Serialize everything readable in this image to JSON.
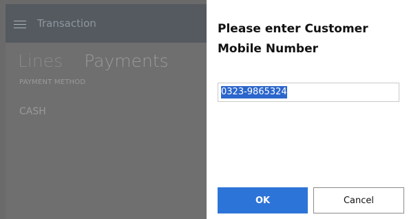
{
  "background": {
    "header": {
      "title": "Transaction",
      "menu_icon": "hamburger-icon"
    },
    "tabs": [
      {
        "label": "Lines"
      },
      {
        "label": "Payments"
      }
    ],
    "table": {
      "column_header": "PAYMENT METHOD",
      "rows": [
        {
          "payment_method": "CASH"
        }
      ]
    }
  },
  "dialog": {
    "title": "Please enter Customer Mobile Number",
    "input": {
      "value": "0323-9865324"
    },
    "buttons": {
      "ok": "OK",
      "cancel": "Cancel"
    }
  },
  "colors": {
    "primary_button": "#2d74d8",
    "text_selection": "#2b66cc",
    "overlay_dim": "#6f6f6f"
  }
}
